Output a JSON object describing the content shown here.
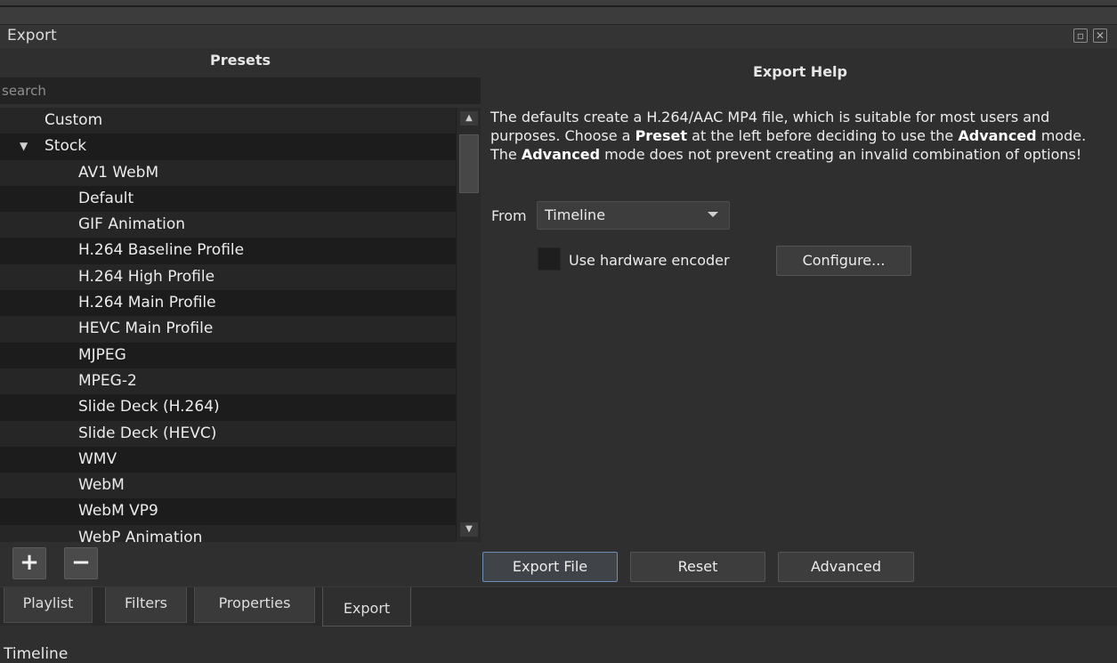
{
  "dock": {
    "title": "Export",
    "float_icon": "float-icon",
    "close_icon": "close-icon"
  },
  "presets": {
    "title": "Presets",
    "search_placeholder": "search",
    "items": [
      {
        "label": "Custom",
        "level": 0
      },
      {
        "label": "Stock",
        "level": 0,
        "expanded": true
      },
      {
        "label": "AV1 WebM",
        "level": 1
      },
      {
        "label": "Default",
        "level": 1
      },
      {
        "label": "GIF Animation",
        "level": 1
      },
      {
        "label": "H.264 Baseline Profile",
        "level": 1
      },
      {
        "label": "H.264 High Profile",
        "level": 1
      },
      {
        "label": "H.264 Main Profile",
        "level": 1
      },
      {
        "label": "HEVC Main Profile",
        "level": 1
      },
      {
        "label": "MJPEG",
        "level": 1
      },
      {
        "label": "MPEG-2",
        "level": 1
      },
      {
        "label": "Slide Deck (H.264)",
        "level": 1
      },
      {
        "label": "Slide Deck (HEVC)",
        "level": 1
      },
      {
        "label": "WMV",
        "level": 1
      },
      {
        "label": "WebM",
        "level": 1
      },
      {
        "label": "WebM VP9",
        "level": 1
      },
      {
        "label": "WebP Animation",
        "level": 1
      }
    ],
    "add_label": "+",
    "remove_label": "−"
  },
  "help": {
    "title": "Export Help",
    "t1": "The defaults create a H.264/AAC MP4 file, which is suitable for most users and purposes. Choose a ",
    "b1": "Preset",
    "t2": " at the left before deciding to use the ",
    "b2": "Advanced",
    "t3": " mode. The ",
    "b3": "Advanced",
    "t4": " mode does not prevent creating an invalid combination of options!"
  },
  "source": {
    "from_label": "From",
    "selected": "Timeline"
  },
  "hardware": {
    "label": "Use hardware encoder",
    "checked": false,
    "configure_label": "Configure..."
  },
  "actions": {
    "export_label": "Export File",
    "reset_label": "Reset",
    "advanced_label": "Advanced"
  },
  "tabs": [
    "Playlist",
    "Filters",
    "Properties",
    "Export"
  ],
  "active_tab": "Export",
  "status": {
    "text": "Timeline"
  }
}
